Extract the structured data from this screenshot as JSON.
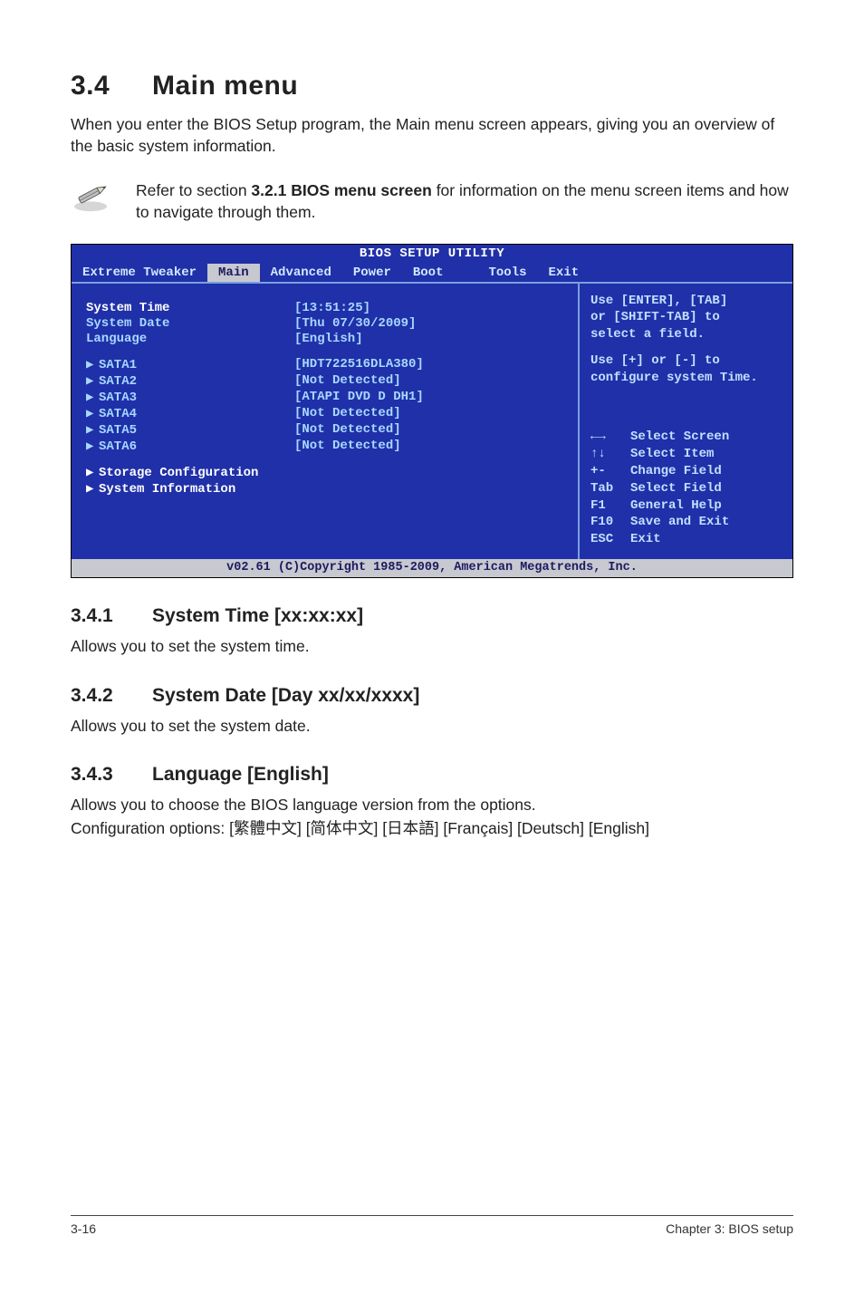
{
  "section": {
    "number": "3.4",
    "title": "Main menu"
  },
  "intro": "When you enter the BIOS Setup program, the Main menu screen appears, giving you an overview of the basic system information.",
  "note": {
    "text_pre": "Refer to section ",
    "bold": "3.2.1  BIOS menu screen",
    "text_post": " for information on the menu screen items and how to navigate through them."
  },
  "bios": {
    "title": "BIOS SETUP UTILITY",
    "tabs": {
      "t0": "Extreme Tweaker",
      "t1": "Main",
      "t2": "Advanced",
      "t3": "Power",
      "t4": "Boot",
      "t5": "Tools",
      "t6": "Exit"
    },
    "fields": {
      "system_time_lbl": "System Time",
      "system_time_val": "[13:51:25]",
      "system_date_lbl": "System Date",
      "system_date_val": "[Thu 07/30/2009]",
      "language_lbl": "Language",
      "language_val": "[English]",
      "sata1_lbl": "SATA1",
      "sata1_val": "[HDT722516DLA380]",
      "sata2_lbl": "SATA2",
      "sata2_val": "[Not Detected]",
      "sata3_lbl": "SATA3",
      "sata3_val": "[ATAPI DVD D DH1]",
      "sata4_lbl": "SATA4",
      "sata4_val": "[Not Detected]",
      "sata5_lbl": "SATA5",
      "sata5_val": "[Not Detected]",
      "sata6_lbl": "SATA6",
      "sata6_val": "[Not Detected]",
      "storage_cfg": "Storage Configuration",
      "system_info": "System Information"
    },
    "help": {
      "l1": "Use [ENTER], [TAB]",
      "l2": "or [SHIFT-TAB] to",
      "l3": "select a field.",
      "l4": "Use [+] or [-] to",
      "l5": "configure system Time."
    },
    "keys": {
      "k0": {
        "k": "←→",
        "d": "Select Screen"
      },
      "k1": {
        "k": "↑↓",
        "d": "Select Item"
      },
      "k2": {
        "k": "+-",
        "d": "Change Field"
      },
      "k3": {
        "k": "Tab",
        "d": "Select Field"
      },
      "k4": {
        "k": "F1",
        "d": "General Help"
      },
      "k5": {
        "k": "F10",
        "d": "Save and Exit"
      },
      "k6": {
        "k": "ESC",
        "d": "Exit"
      }
    },
    "footer": "v02.61 (C)Copyright 1985-2009, American Megatrends, Inc."
  },
  "sub": {
    "s1": {
      "num": "3.4.1",
      "title": "System Time [xx:xx:xx]",
      "body": "Allows you to set the system time."
    },
    "s2": {
      "num": "3.4.2",
      "title": "System Date [Day xx/xx/xxxx]",
      "body": "Allows you to set the system date."
    },
    "s3": {
      "num": "3.4.3",
      "title": "Language [English]",
      "body1": "Allows you to choose the BIOS language version from the options.",
      "body2": "Configuration options: [繁體中文] [简体中文] [日本語] [Français] [Deutsch] [English]"
    }
  },
  "footer": {
    "left": "3-16",
    "right": "Chapter 3: BIOS setup"
  }
}
